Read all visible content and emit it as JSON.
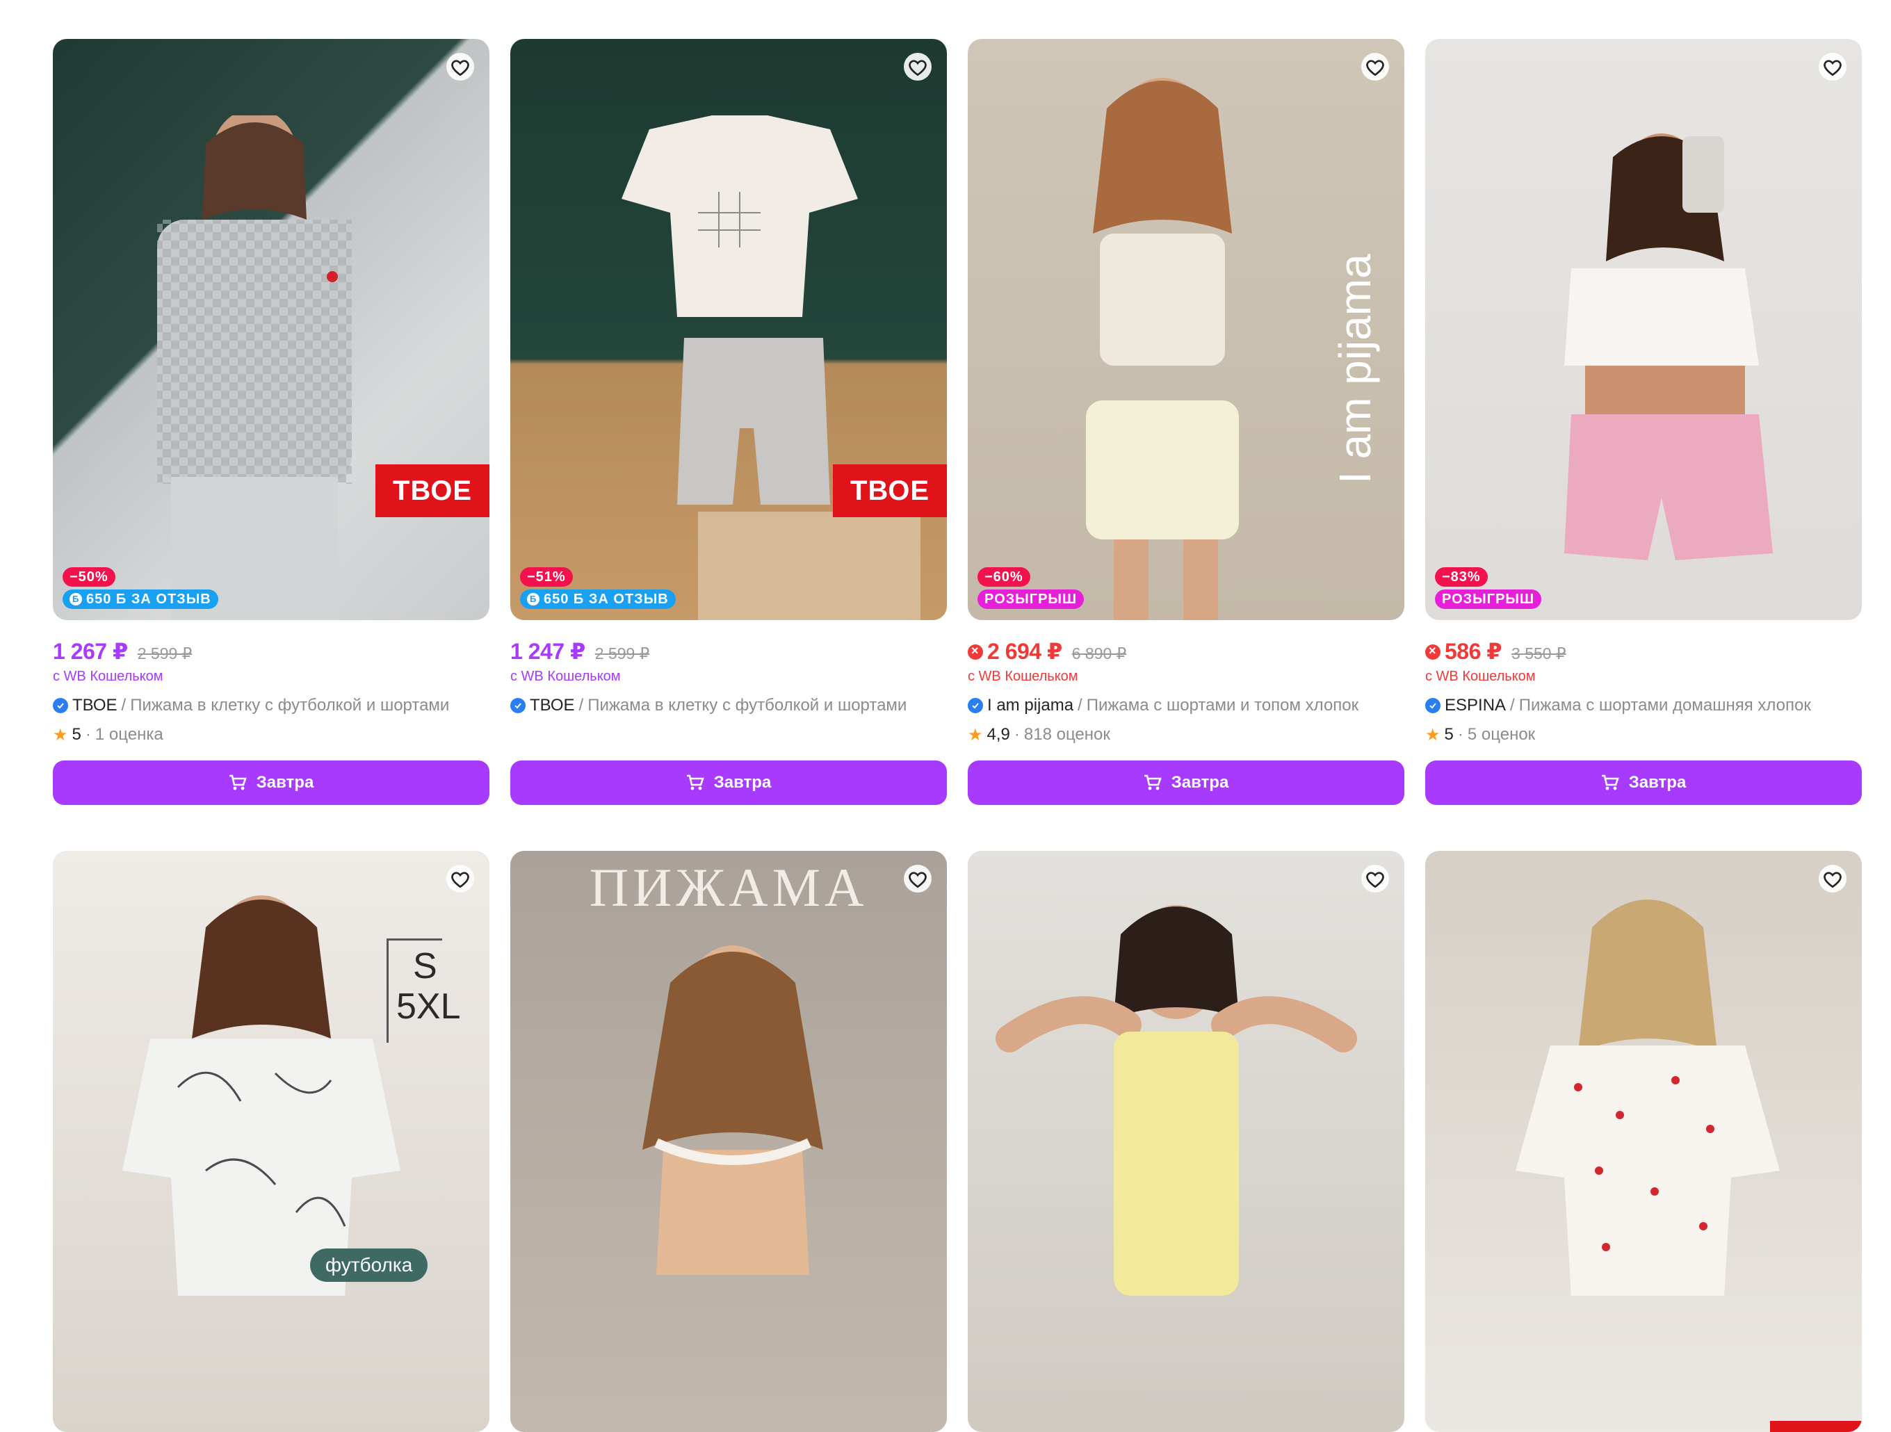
{
  "products": [
    {
      "discount": "−50%",
      "promo": "650 Б ЗА ОТЗЫВ",
      "brand_tag": "ТВОЕ",
      "price": "1 267 ₽",
      "old_price": "2 599 ₽",
      "wallet": "с WB Кошельком",
      "brand": "ТВОЕ",
      "title": "Пижама в клетку с футболкой и шортами",
      "rating": "5",
      "reviews": "1 оценка",
      "button": "Завтра"
    },
    {
      "discount": "−51%",
      "promo": "650 Б ЗА ОТЗЫВ",
      "brand_tag": "ТВОЕ",
      "price": "1 247 ₽",
      "old_price": "2 599 ₽",
      "wallet": "с WB Кошельком",
      "brand": "ТВОЕ",
      "title": "Пижама в клетку с футболкой и шортами",
      "button": "Завтра"
    },
    {
      "discount": "−60%",
      "promo": "РОЗЫГРЫШ",
      "overlay": "I am pijama",
      "price": "2 694 ₽",
      "old_price": "6 890 ₽",
      "wallet": "с WB Кошельком",
      "brand": "I am pijama",
      "title": "Пижама с шортами и топом хлопок",
      "rating": "4,9",
      "reviews": "818 оценок",
      "button": "Завтра"
    },
    {
      "discount": "−83%",
      "promo": "РОЗЫГРЫШ",
      "price": "586 ₽",
      "old_price": "3 550 ₽",
      "wallet": "с WB Кошельком",
      "brand": "ESPINA",
      "title": "Пижама с шортами домашняя хлопок",
      "rating": "5",
      "reviews": "5 оценок",
      "button": "Завтра"
    },
    {
      "size_top": "S",
      "size_bottom": "5XL",
      "chip": "футболка"
    },
    {
      "overlay": "ПИЖАМА"
    },
    {},
    {}
  ],
  "colors": {
    "accent": "#a73afd",
    "hot_price": "#f03a3a",
    "discount_badge": "#f4124e",
    "review_badge": "#1aa0f2",
    "raffle_badge": "#e620d8"
  }
}
